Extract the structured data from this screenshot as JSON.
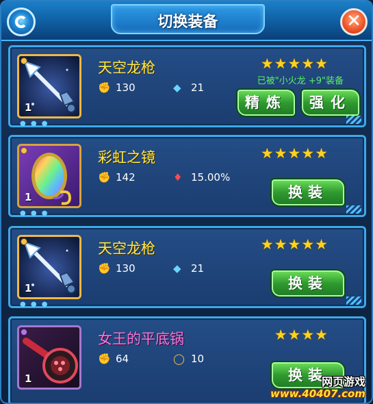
{
  "header": {
    "title": "切换装备",
    "logo_icon": "spiral-logo-icon",
    "close_icon": "close-x-icon"
  },
  "items": [
    {
      "name": "天空龙枪",
      "quantity": "1",
      "stars": "★★★★★",
      "equipped_text": "已被\"小火龙 +9\"装备",
      "stat1_icon": "attack-hand-icon",
      "stat1_value": "130",
      "stat2_icon": "water-drop-gem-icon",
      "stat2_value": "21",
      "buttons": [
        "精炼",
        "强化"
      ]
    },
    {
      "name": "彩虹之镜",
      "quantity": "1",
      "stars": "★★★★★",
      "stat1_icon": "attack-hand-icon",
      "stat1_value": "142",
      "stat2_icon": "blood-drop-icon",
      "stat2_value": "15.00%",
      "buttons": [
        "换装"
      ]
    },
    {
      "name": "天空龙枪",
      "quantity": "1",
      "stars": "★★★★★",
      "stat1_icon": "attack-hand-icon",
      "stat1_value": "130",
      "stat2_icon": "water-drop-gem-icon",
      "stat2_value": "21",
      "buttons": [
        "换装"
      ]
    },
    {
      "name": "女王的平底锅",
      "quantity": "1",
      "stars": "★★★★",
      "stat1_icon": "attack-hand-icon",
      "stat1_value": "64",
      "stat2_icon": "ring-icon",
      "stat2_value": "10",
      "buttons": [
        "换装"
      ]
    }
  ],
  "watermark": {
    "top": "网页游戏",
    "bottom": "www.40407.com"
  },
  "colors": {
    "title": "#ffffff",
    "item_name": "#ffe84a",
    "item_name_special": "#f07bd8",
    "stars": "#ffd21f",
    "equipped_text": "#5cf064",
    "button_green": "#2f9a2f"
  }
}
